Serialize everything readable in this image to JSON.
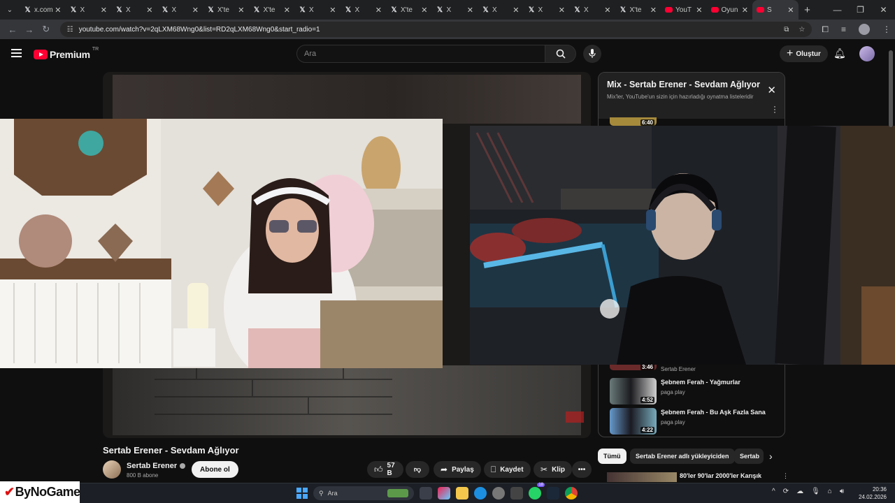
{
  "browser": {
    "tabs": [
      {
        "label": "x.com",
        "icon": "x-logo-icon"
      },
      {
        "label": "X",
        "icon": "x-logo-icon"
      },
      {
        "label": "X",
        "icon": "x-logo-icon"
      },
      {
        "label": "X",
        "icon": "x-logo-icon"
      },
      {
        "label": "X'te",
        "icon": "x-logo-icon"
      },
      {
        "label": "X'te",
        "icon": "x-logo-icon"
      },
      {
        "label": "X",
        "icon": "x-logo-icon"
      },
      {
        "label": "X",
        "icon": "x-logo-icon"
      },
      {
        "label": "X'te",
        "icon": "x-logo-icon"
      },
      {
        "label": "X",
        "icon": "x-logo-icon"
      },
      {
        "label": "X",
        "icon": "x-logo-icon"
      },
      {
        "label": "X",
        "icon": "x-logo-icon"
      },
      {
        "label": "X",
        "icon": "x-logo-icon"
      },
      {
        "label": "X'te",
        "icon": "x-logo-icon"
      },
      {
        "label": "YouT",
        "icon": "youtube-icon"
      },
      {
        "label": "Oyun",
        "icon": "youtube-icon"
      },
      {
        "label": "S",
        "icon": "youtube-icon"
      }
    ],
    "url": "youtube.com/watch?v=2qLXM68Wng0&list=RD2qLXM68Wng0&start_radio=1"
  },
  "masthead": {
    "logo_text": "Premium",
    "country": "TR",
    "search_placeholder": "Ara",
    "create_label": "Oluştur"
  },
  "playlist": {
    "title": "Mix - Sertab Erener - Sevdam Ağlıyor",
    "subtitle": "Mix'ler, YouTube'un sizin için hazırladığı oynatma listeleridir",
    "partial_top_duration": "6:40",
    "items": [
      {
        "duration": "3:46",
        "title": "",
        "channel": "Sertab Erener"
      },
      {
        "duration": "4:52",
        "title": "Şebnem Ferah - Yağmurlar",
        "channel": "paga play"
      },
      {
        "duration": "4:22",
        "title": "Şebnem Ferah - Bu Aşk Fazla Sana",
        "channel": "paga play"
      }
    ]
  },
  "video": {
    "title": "Sertab Erener - Sevdam Ağlıyor",
    "channel": "Sertab Erener",
    "subscribers": "800 B abone",
    "subscribe_label": "Abone ol",
    "likes": "57 B",
    "share_label": "Paylaş",
    "save_label": "Kaydet",
    "clip_label": "Klip"
  },
  "chips": [
    "Tümü",
    "Sertab Erener adlı yükleyiciden",
    "Sertab"
  ],
  "recommendation": {
    "title": "80'ler 90'lar 2000'ler Karışık"
  },
  "taskbar": {
    "brand": "ByNoGame",
    "search_placeholder": "Ara",
    "badge_count": "18",
    "time": "20:36",
    "date": "24.02.2026"
  },
  "colors": {
    "youtube_red": "#ff0033",
    "background": "#0f0f0f",
    "chip_bg": "#272727"
  }
}
